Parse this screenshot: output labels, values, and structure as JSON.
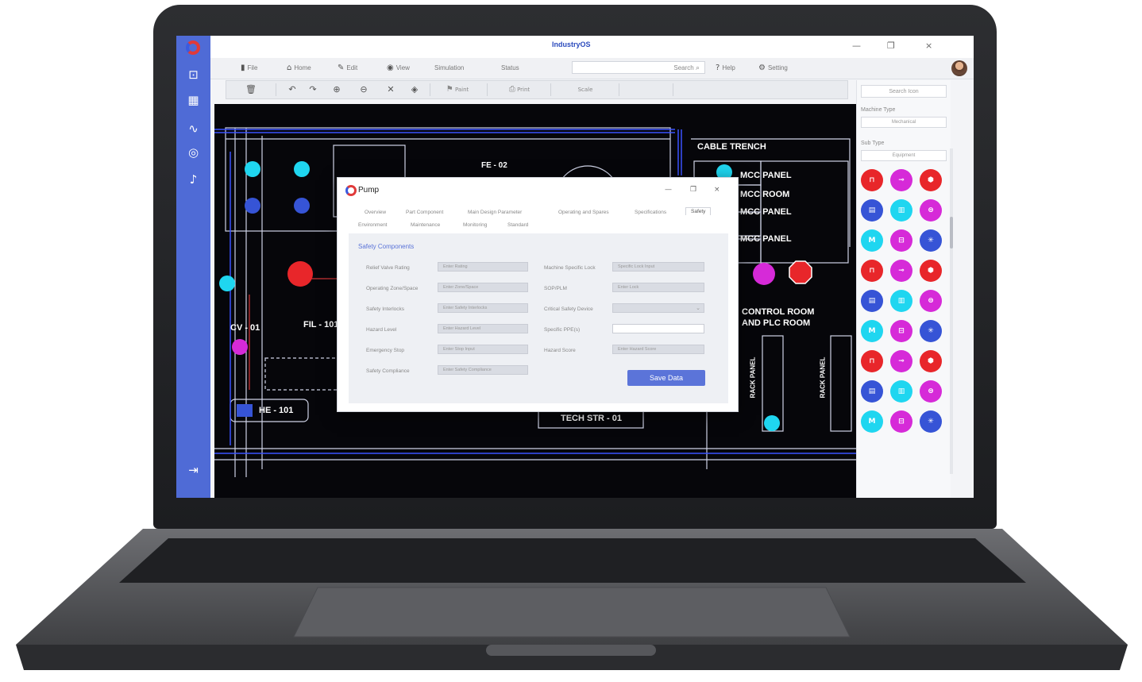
{
  "app": {
    "title": "IndustryOS",
    "window_controls": [
      "—",
      "❐",
      "×"
    ]
  },
  "rail": {
    "icons": [
      "layers-icon",
      "grid-icon",
      "activity-icon",
      "target-icon",
      "bell-icon",
      "logout-icon"
    ]
  },
  "menubar": {
    "items": [
      {
        "icon": "file-icon",
        "label": "File"
      },
      {
        "icon": "home-icon",
        "label": "Home"
      },
      {
        "icon": "edit-icon",
        "label": "Edit"
      },
      {
        "icon": "view-icon",
        "label": "View"
      },
      {
        "icon": "",
        "label": "Simulation"
      },
      {
        "icon": "",
        "label": "Status"
      }
    ],
    "search_placeholder": "Search",
    "help_label": "Help",
    "setting_label": "Setting"
  },
  "toolbar": {
    "buttons": [
      "delete-icon",
      "undo-icon",
      "redo-icon",
      "zoom-in-icon",
      "zoom-out-icon",
      "close-icon",
      "fill-icon",
      "paint-icon",
      "print-icon"
    ],
    "paint_label": "Paint",
    "print_label": "Print",
    "scale_label": "Scale"
  },
  "right_panel": {
    "search_placeholder": "Search Icon",
    "machine_type_label": "Machine Type",
    "machine_type_value": "Mechanical",
    "sub_type_label": "Sub Type",
    "sub_type_value": "Equipment",
    "symbol_colors": {
      "red": "#e8262a",
      "magenta": "#d62ad8",
      "blue": "#3654d6",
      "cyan": "#1fd6f0"
    }
  },
  "canvas": {
    "labels": {
      "cable_trench": "CABLE TRENCH",
      "fe02": "FE - 02",
      "mcc_panel_1": "MCC PANEL",
      "mcc_room": "MCC ROOM",
      "mcc_panel_2": "MCC PANEL",
      "mcc_panel_3": "MCC PANEL",
      "control_room": "CONTROL ROOM",
      "plc_room": "AND PLC ROOM",
      "cv01": "CV - 01",
      "fil101": "FIL - 101",
      "he101": "HE - 101",
      "tech_str": "TECH STR - 01",
      "rack_panel_1": "RACK PANEL",
      "rack_panel_2": "RACK PANEL"
    }
  },
  "dialog": {
    "title": "Pump",
    "tabs_row1": [
      "Overview",
      "Part Component",
      "Main Design Parameter",
      "Operating and Spares",
      "Specifications",
      "Safety"
    ],
    "tabs_row2": [
      "Environment",
      "Maintenance",
      "Monitoring",
      "Standard"
    ],
    "active_tab": "Safety",
    "section_heading": "Safety Components",
    "fields_left": [
      {
        "label": "Relief Valve Rating",
        "value": "Enter Rating"
      },
      {
        "label": "Operating Zone/Space",
        "value": "Enter Zone/Space"
      },
      {
        "label": "Safety Interlocks",
        "value": "Enter Safety Interlocks"
      },
      {
        "label": "Hazard Level",
        "value": "Enter Hazard Level"
      },
      {
        "label": "Emergency Stop",
        "value": "Enter Stop Input"
      },
      {
        "label": "Safety Compliance",
        "value": "Enter Safety Compliance"
      }
    ],
    "fields_right": [
      {
        "label": "Machine Specific Lock",
        "value": "Specific Lock Input"
      },
      {
        "label": "SOP/PLM",
        "value": "Enter Lock"
      },
      {
        "label": "Critical Safety Device",
        "value": ""
      },
      {
        "label": "Specific PPE(s)",
        "value": ""
      },
      {
        "label": "Hazard Score",
        "value": "Enter Hazard Score"
      }
    ],
    "save_label": "Save Data"
  }
}
